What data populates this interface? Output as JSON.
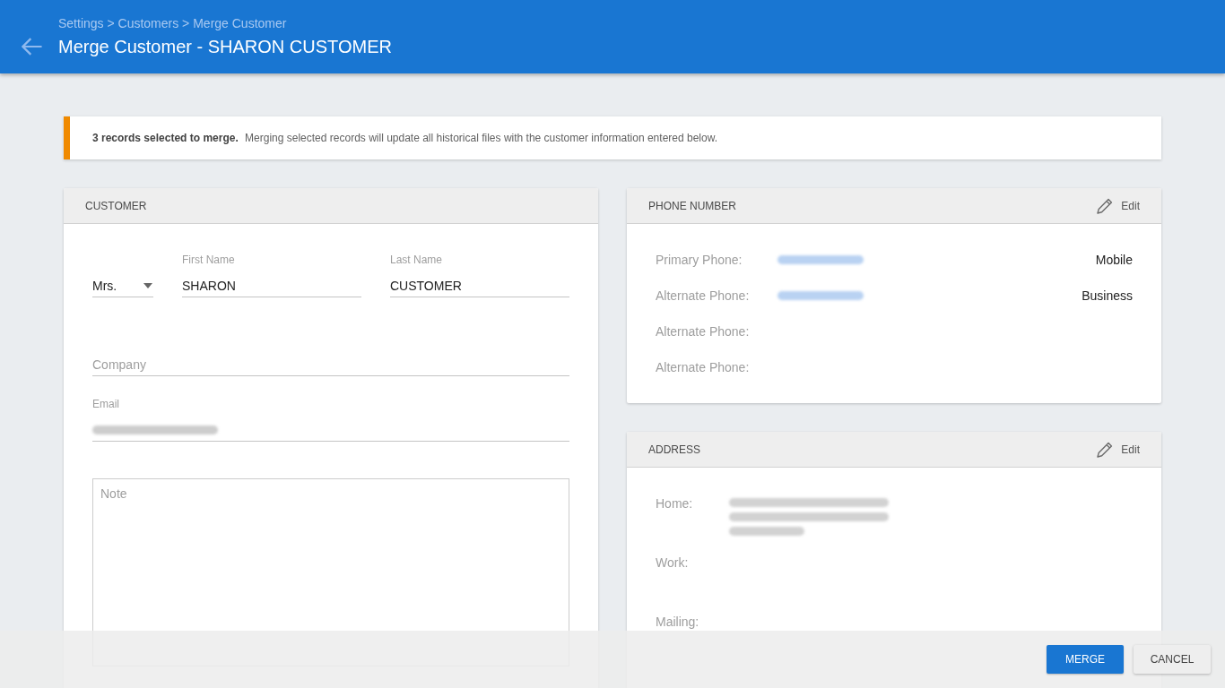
{
  "header": {
    "breadcrumb": "Settings > Customers > Merge Customer",
    "title": "Merge Customer - SHARON CUSTOMER"
  },
  "notice": {
    "text": "**3 records selected to merge.** Merging selected records will update all historical files with the customer information entered below."
  },
  "customer": {
    "title": "CUSTOMER",
    "salutation": {
      "value": "Mrs."
    },
    "first_name": {
      "label": "First Name",
      "value": "SHARON"
    },
    "last_name": {
      "label": "Last Name",
      "value": "CUSTOMER"
    },
    "company": {
      "placeholder": "Company"
    },
    "email": {
      "label": "Email",
      "blurred": true
    },
    "note": {
      "placeholder": "Note"
    }
  },
  "phone_card": {
    "title": "PHONE NUMBER",
    "edit": "Edit",
    "rows": [
      {
        "label": "Primary Phone:",
        "blurred": true,
        "type": "Mobile"
      },
      {
        "label": "Alternate Phone:",
        "blurred": true,
        "type": "Business"
      },
      {
        "label": "Alternate Phone:",
        "blurred": false
      },
      {
        "label": "Alternate Phone:",
        "blurred": false
      }
    ]
  },
  "address_card": {
    "title": "ADDRESS",
    "edit": "Edit",
    "rows": [
      {
        "label": "Home:",
        "blurred": true
      },
      {
        "label": "Work:",
        "blurred": false
      },
      {
        "label": "Mailing:",
        "blurred": false
      }
    ]
  },
  "actions": [
    {
      "label": "MERGE",
      "kind": "primary"
    },
    {
      "label": "CANCEL",
      "kind": "secondary"
    }
  ]
}
